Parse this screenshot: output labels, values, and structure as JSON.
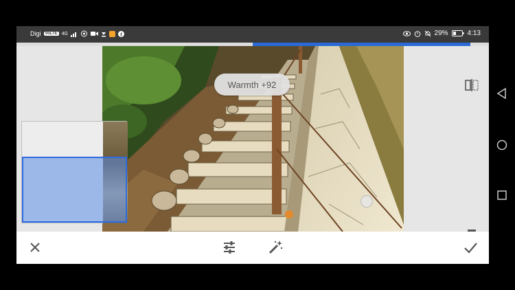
{
  "statusbar": {
    "carrier": "Digi",
    "network_badge": "VoLTE",
    "signal_text": "4G",
    "battery": "29%",
    "time": "4:13"
  },
  "progress": {
    "value": 0.46
  },
  "editor": {
    "toast": "Warmth +92"
  },
  "toolbar": {
    "cancel_icon": "close-icon",
    "tune_icon": "tune-icon",
    "auto_icon": "magic-wand-icon",
    "apply_icon": "check-icon"
  },
  "nav": {
    "back_icon": "triangle-back-icon",
    "home_icon": "circle-home-icon",
    "recents_icon": "square-recents-icon"
  },
  "colors": {
    "accent": "#2b6ad6",
    "statusbar": "#3a3a3a",
    "icon": "#555555"
  }
}
